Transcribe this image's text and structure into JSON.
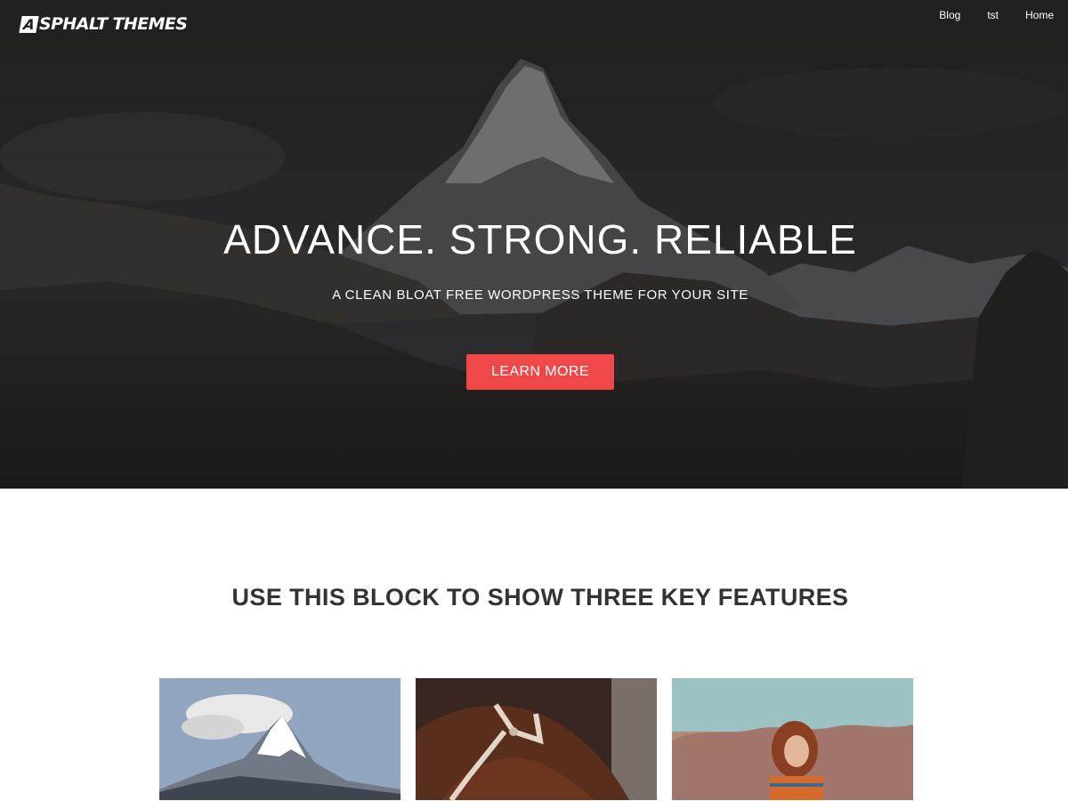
{
  "header": {
    "logo_letter": "A",
    "logo_text": "SPHALT THEMES",
    "nav": [
      {
        "label": "Blog"
      },
      {
        "label": "tst"
      },
      {
        "label": "Home"
      }
    ]
  },
  "hero": {
    "title": "ADVANCE. STRONG. RELIABLE",
    "subtitle": "A CLEAN BLOAT FREE WORDPRESS THEME FOR YOUR SITE",
    "button_label": "LEARN MORE",
    "button_color": "#f04849"
  },
  "features": {
    "title": "USE THIS BLOCK TO SHOW THREE KEY FEATURES",
    "cards": [
      {
        "image": "snowy-mountain-image"
      },
      {
        "image": "horse-with-halter-image"
      },
      {
        "image": "woman-in-field-image"
      }
    ]
  }
}
